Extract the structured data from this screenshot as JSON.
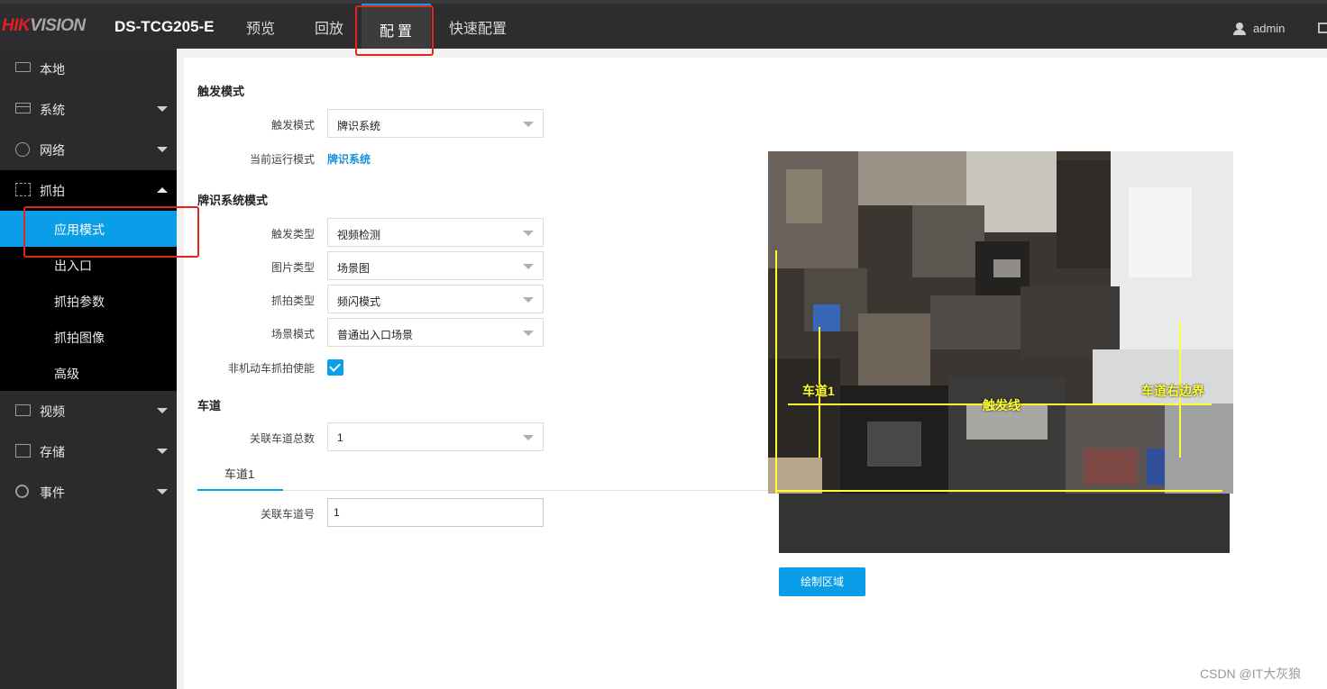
{
  "header": {
    "brand_hik": "HIK",
    "brand_vision": "VISION",
    "model": "DS-TCG205-E",
    "nav": [
      {
        "label": "预览"
      },
      {
        "label": "回放"
      },
      {
        "label": "配置",
        "active": true
      },
      {
        "label": "快速配置"
      }
    ],
    "user": "admin"
  },
  "sidebar": {
    "items": [
      {
        "label": "本地",
        "icon": "monitor-icon"
      },
      {
        "label": "系统",
        "icon": "system-icon"
      },
      {
        "label": "网络",
        "icon": "network-icon"
      },
      {
        "label": "抓拍",
        "icon": "capture-icon",
        "expanded": true
      },
      {
        "label": "视频",
        "icon": "video-icon"
      },
      {
        "label": "存储",
        "icon": "storage-icon"
      },
      {
        "label": "事件",
        "icon": "event-icon"
      }
    ],
    "sub_items": [
      {
        "label": "应用模式",
        "active": true
      },
      {
        "label": "出入口"
      },
      {
        "label": "抓拍参数"
      },
      {
        "label": "抓拍图像"
      },
      {
        "label": "高级"
      }
    ]
  },
  "form": {
    "trigger_section": "触发模式",
    "trigger_mode_label": "触发模式",
    "trigger_mode_value": "牌识系统",
    "current_mode_label": "当前运行模式",
    "current_mode_value": "牌识系统",
    "plate_section": "牌识系统模式",
    "trigger_type_label": "触发类型",
    "trigger_type_value": "视频检测",
    "pic_type_label": "图片类型",
    "pic_type_value": "场景图",
    "capture_type_label": "抓拍类型",
    "capture_type_value": "频闪模式",
    "scene_mode_label": "场景模式",
    "scene_mode_value": "普通出入口场景",
    "nonmotor_label": "非机动车抓拍使能",
    "nonmotor_checked": true,
    "lane_section": "车道",
    "lane_total_label": "关联车道总数",
    "lane_total_value": "1",
    "lane_tab": "车道1",
    "lane_no_label": "关联车道号",
    "lane_no_value": "1"
  },
  "preview": {
    "lane_label": "车道1",
    "right_boundary_label": "车道右边界",
    "trigger_line_label": "触发线",
    "draw_button": "绘制区域"
  },
  "watermark": "CSDN @IT大灰狼",
  "colors": {
    "accent": "#0a9ee8",
    "topbar": "#2d2d2f",
    "sidebar": "#2a2b2d",
    "highlight_box": "#e3261a",
    "overlay": "#ffff33"
  }
}
